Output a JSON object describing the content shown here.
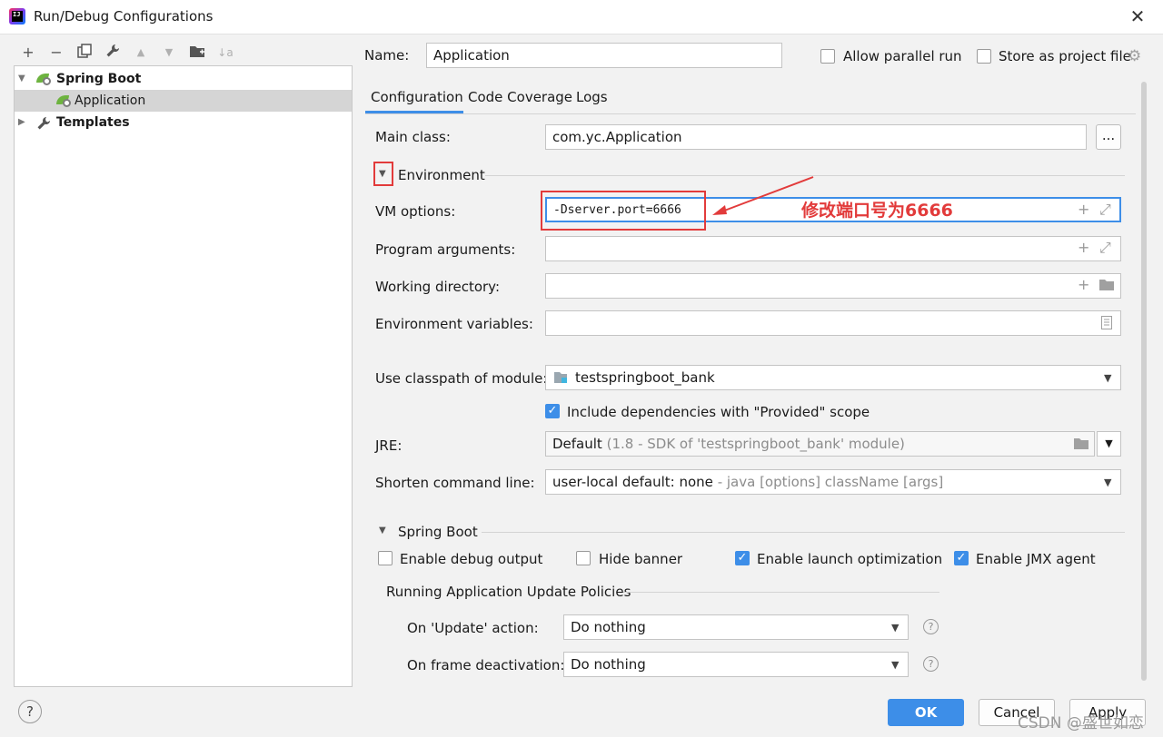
{
  "window": {
    "title": "Run/Debug Configurations",
    "close_glyph": "✕"
  },
  "toolbar": {
    "add": "+",
    "remove": "−",
    "copy": "⧉",
    "edit": "🔧",
    "up": "▲",
    "down": "▼",
    "folder": "📁",
    "sort": "↓a"
  },
  "tree": {
    "items": [
      {
        "label": "Spring Boot",
        "expanded": true
      },
      {
        "label": "Application",
        "selected": true
      },
      {
        "label": "Templates",
        "expanded": false
      }
    ]
  },
  "form": {
    "name_label": "Name:",
    "name_value": "Application",
    "allow_parallel_label": "Allow parallel run",
    "store_project_label": "Store as project file",
    "tabs": [
      "Configuration",
      "Code Coverage",
      "Logs"
    ],
    "main_class_label": "Main class:",
    "main_class_value": "com.yc.Application",
    "browse_label": "...",
    "environment_label": "Environment",
    "vm_options_label": "VM options:",
    "vm_options_value": "-Dserver.port=6666",
    "program_args_label": "Program arguments:",
    "working_dir_label": "Working directory:",
    "env_vars_label": "Environment variables:",
    "classpath_label": "Use classpath of module:",
    "classpath_value": "testspringboot_bank",
    "include_deps_label": "Include dependencies with \"Provided\" scope",
    "jre_label": "JRE:",
    "jre_value": "Default",
    "jre_hint": "(1.8 - SDK of 'testspringboot_bank' module)",
    "shorten_label": "Shorten command line:",
    "shorten_value": "user-local default: none",
    "shorten_hint": "- java [options] className [args]",
    "spring_boot_section": "Spring Boot",
    "debug_output_label": "Enable debug output",
    "hide_banner_label": "Hide banner",
    "launch_opt_label": "Enable launch optimization",
    "jmx_label": "Enable JMX agent",
    "update_policies_label": "Running Application Update Policies",
    "on_update_label": "On 'Update' action:",
    "on_update_value": "Do nothing",
    "on_frame_label": "On frame deactivation:",
    "on_frame_value": "Do nothing"
  },
  "buttons": {
    "ok": "OK",
    "cancel": "Cancel",
    "apply": "Apply",
    "help": "?"
  },
  "annotation": {
    "text": "修改端口号为6666"
  },
  "watermark": "CSDN @盛世如恋",
  "colors": {
    "accent": "#3d8ee8",
    "annotation": "#e23b3b",
    "selection": "#d5d5d5"
  }
}
